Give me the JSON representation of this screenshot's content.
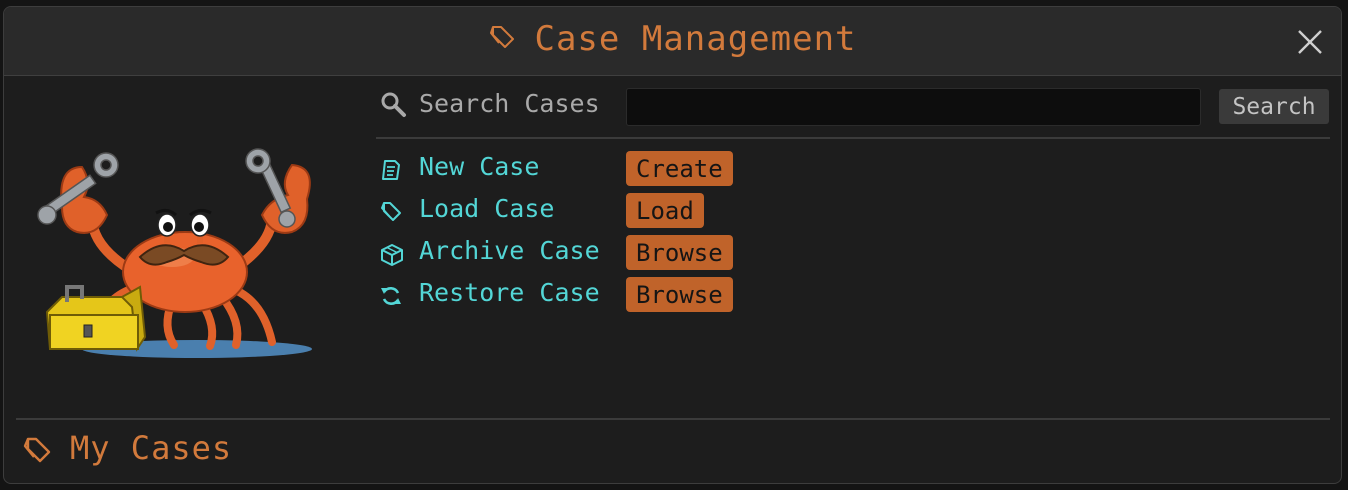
{
  "window": {
    "title": "Case Management",
    "accent_color": "#d27a3c",
    "close_icon": "close-icon",
    "title_icon": "folder-tag-icon"
  },
  "mascot": {
    "description_icon": "crab-mechanic-mascot"
  },
  "search": {
    "label": "Search Cases",
    "value": "",
    "placeholder": "",
    "button_label": "Search",
    "icon": "search-icon"
  },
  "actions": [
    {
      "label": "New Case",
      "button": "Create",
      "icon": "new-document-icon"
    },
    {
      "label": "Load Case",
      "button": "Load",
      "icon": "folder-open-icon"
    },
    {
      "label": "Archive Case",
      "button": "Browse",
      "icon": "archive-box-icon"
    },
    {
      "label": "Restore Case",
      "button": "Browse",
      "icon": "restore-icon"
    }
  ],
  "footer": {
    "label": "My Cases",
    "icon": "folder-tag-icon"
  },
  "colors": {
    "label_cyan": "#53d6d6",
    "button_orange": "#c0632a",
    "background": "#1d1d1d",
    "titlebar": "#2a2a2a"
  }
}
